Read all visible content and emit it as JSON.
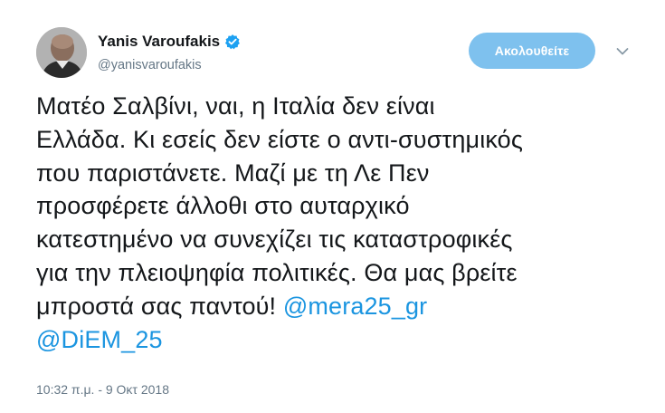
{
  "author": {
    "display_name": "Yanis Varoufakis",
    "handle": "@yanisvaroufakis",
    "verified_icon": "verified-badge-icon",
    "avatar_icon": "profile-photo"
  },
  "follow_button": {
    "label": "Ακολουθείτε"
  },
  "menu": {
    "icon": "chevron-down-icon"
  },
  "tweet": {
    "lines": [
      "Ματέο Σαλβίνι, ναι, η Ιταλία δεν είναι",
      "Ελλάδα. Κι εσείς δεν είστε ο αντι-συστημικός",
      "που παριστάνετε. Μαζί με τη Λε Πεν",
      "προσφέρετε άλλοθι στο αυταρχικό",
      "κατεστημένο να συνεχίζει τις καταστροφικές",
      "για την πλειοψηφία πολιτικές. Θα μας βρείτε"
    ],
    "line7_text": "μπροστά σας παντού! ",
    "mention1": "@mera25_gr",
    "mention2": "@DiEM_25"
  },
  "timestamp": "10:32 π.μ. - 9 Οκτ 2018",
  "colors": {
    "link": "#1b95e0",
    "follow_button_bg": "#7ec1ee",
    "secondary_text": "#657786",
    "verified": "#1da1f2"
  }
}
